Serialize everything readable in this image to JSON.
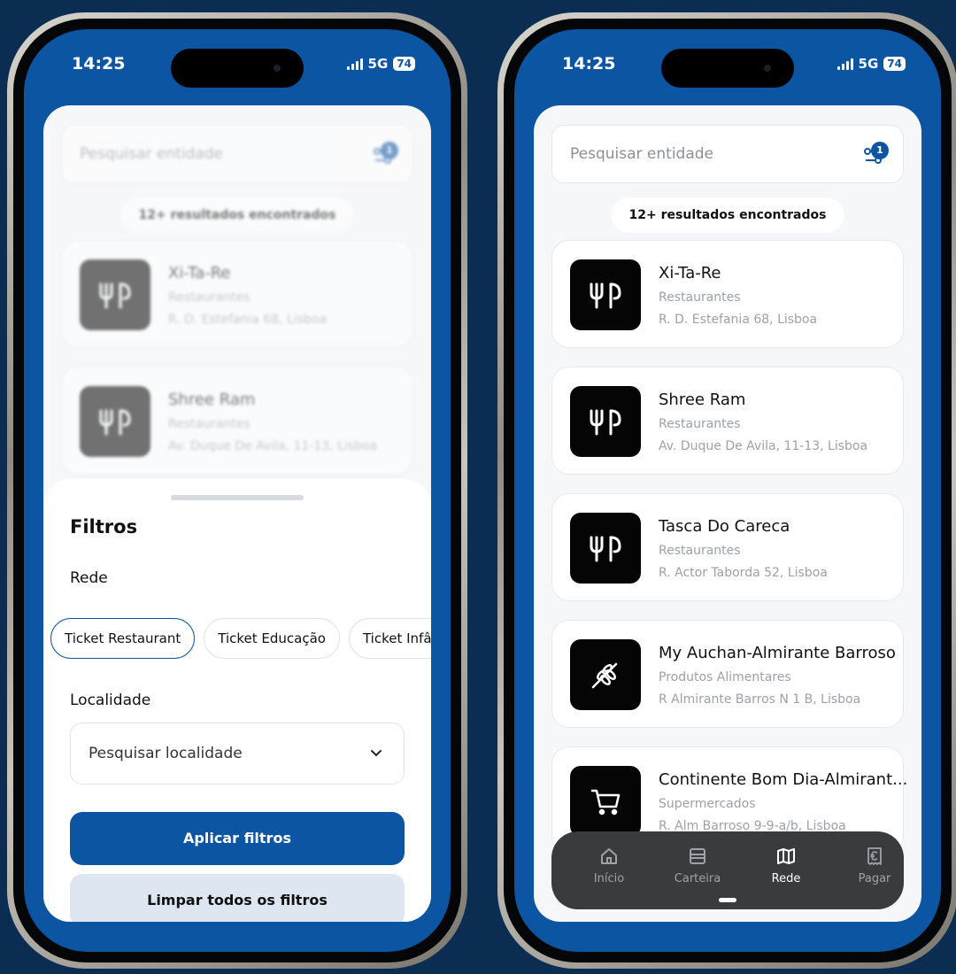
{
  "status": {
    "time": "14:25",
    "network": "5G",
    "battery": "74"
  },
  "search": {
    "placeholder": "Pesquisar entidade",
    "filter_count": "1"
  },
  "results_label": "12+ resultados encontrados",
  "left_cards": [
    {
      "name": "Xi-Ta-Re",
      "category": "Restaurantes",
      "address": "R. D. Estefania 68, Lisboa",
      "icon": "fork-knife-icon"
    },
    {
      "name": "Shree Ram",
      "category": "Restaurantes",
      "address": "Av. Duque De Avila, 11-13, Lisboa",
      "icon": "fork-knife-icon"
    }
  ],
  "filters": {
    "title": "Filtros",
    "network_label": "Rede",
    "chips": [
      "Ticket Restaurant",
      "Ticket Educação",
      "Ticket Infância"
    ],
    "locality_label": "Localidade",
    "locality_placeholder": "Pesquisar localidade",
    "apply": "Aplicar filtros",
    "clear": "Limpar todos os filtros"
  },
  "right_cards": [
    {
      "name": "Xi-Ta-Re",
      "category": "Restaurantes",
      "address": "R. D. Estefania 68, Lisboa",
      "icon": "fork-knife-icon"
    },
    {
      "name": "Shree Ram",
      "category": "Restaurantes",
      "address": "Av. Duque De Avila, 11-13, Lisboa",
      "icon": "fork-knife-icon"
    },
    {
      "name": "Tasca Do Careca",
      "category": "Restaurantes",
      "address": "R. Actor Taborda 52, Lisboa",
      "icon": "fork-knife-icon"
    },
    {
      "name": "My Auchan-Almirante Barroso",
      "category": "Produtos Alimentares",
      "address": "R Almirante Barros N 1 B, Lisboa",
      "icon": "wheat-icon"
    },
    {
      "name": "Continente Bom Dia-Almirant...",
      "category": "Supermercados",
      "address": "R. Alm Barroso 9-9-a/b, Lisboa",
      "icon": "cart-icon"
    }
  ],
  "tabs": [
    {
      "label": "Início",
      "icon": "home-icon"
    },
    {
      "label": "Carteira",
      "icon": "wallet-icon"
    },
    {
      "label": "Rede",
      "icon": "map-icon"
    },
    {
      "label": "Pagar",
      "icon": "euro-receipt-icon"
    }
  ],
  "active_tab": "Rede",
  "colors": {
    "brand_blue": "#0c55a3",
    "background": "#0b2d52",
    "tabbar": "#3a3b3d"
  }
}
